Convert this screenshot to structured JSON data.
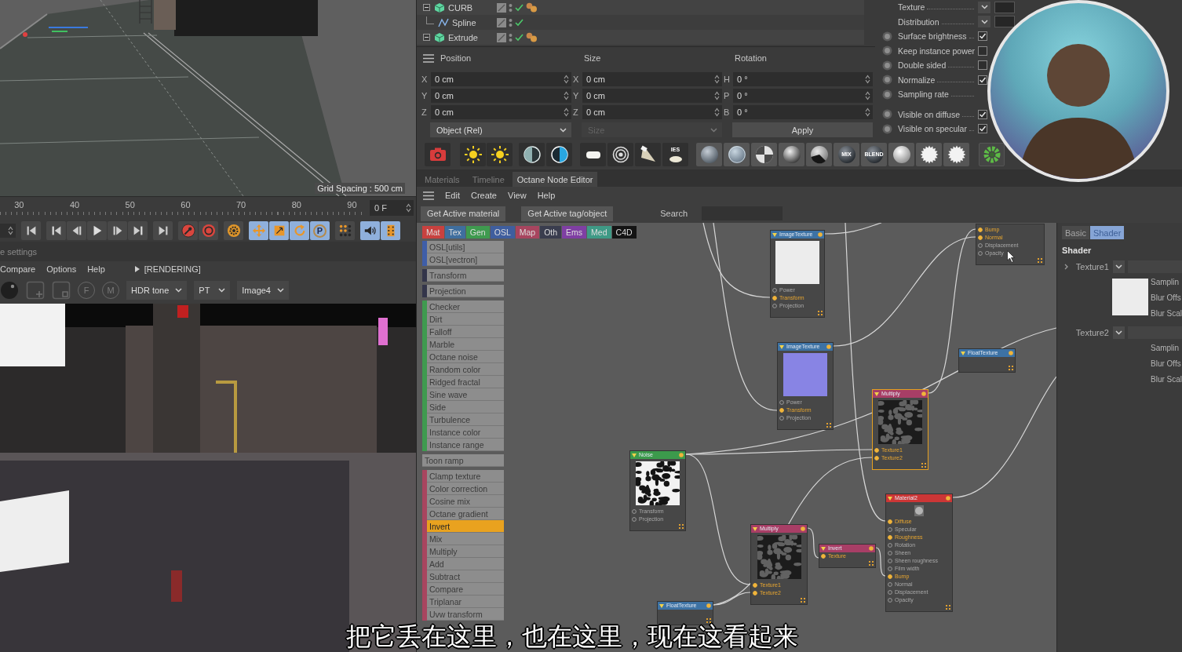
{
  "viewport": {
    "hud": "Grid Spacing : 500 cm"
  },
  "timeline": {
    "ticks": [
      "30",
      "40",
      "50",
      "60",
      "70",
      "80",
      "90"
    ],
    "frame": "0 F"
  },
  "transport": {
    "buttons": [
      {
        "on": false
      },
      {
        "on": false
      },
      {
        "on": false
      },
      {
        "on": false
      },
      {
        "on": false
      },
      {
        "on": false
      },
      {
        "on": false
      },
      {
        "on": false
      },
      {
        "on": false
      },
      {
        "on": false
      },
      {
        "on": true
      },
      {
        "on": true
      },
      {
        "on": true
      },
      {
        "on": true,
        "label": "P"
      },
      {
        "on": false
      },
      {
        "on": true
      },
      {
        "on": true
      }
    ]
  },
  "render_view": {
    "title": "e settings",
    "menu": [
      "Compare",
      "Options",
      "Help"
    ],
    "status": "[RENDERING]",
    "pins": [
      "F",
      "M"
    ],
    "dropdowns": [
      "HDR tone",
      "PT",
      "Image4"
    ]
  },
  "object_manager": {
    "objects": [
      {
        "name": "CURB",
        "kind": "generator",
        "expanded": true,
        "enabled": true,
        "tagged": true,
        "children": [
          {
            "name": "Spline",
            "kind": "spline",
            "enabled": true,
            "tagged": false
          }
        ]
      },
      {
        "name": "Extrude",
        "kind": "generator",
        "expanded": true,
        "enabled": true,
        "tagged": true
      }
    ]
  },
  "coordinates": {
    "columns": [
      {
        "title": "Position",
        "fields": [
          {
            "axis": "X",
            "value": "0 cm"
          },
          {
            "axis": "Y",
            "value": "0 cm"
          },
          {
            "axis": "Z",
            "value": "0 cm"
          }
        ]
      },
      {
        "title": "Size",
        "fields": [
          {
            "axis": "X",
            "value": "0 cm"
          },
          {
            "axis": "Y",
            "value": "0 cm"
          },
          {
            "axis": "Z",
            "value": "0 cm"
          }
        ]
      },
      {
        "title": "Rotation",
        "fields": [
          {
            "axis": "H",
            "value": "0 °"
          },
          {
            "axis": "P",
            "value": "0 °"
          },
          {
            "axis": "B",
            "value": "0 °"
          }
        ]
      }
    ],
    "dropdowns": [
      {
        "value": "Object (Rel)",
        "disabled": false
      },
      {
        "value": "Size",
        "disabled": true
      }
    ],
    "apply": "Apply"
  },
  "attributes": {
    "groups": [
      [
        {
          "label": "Texture",
          "kind": "dropdown"
        },
        {
          "label": "Distribution",
          "kind": "dropdown"
        },
        {
          "label": "Surface brightness",
          "kind": "checkbox",
          "checked": true
        },
        {
          "label": "Keep instance power",
          "kind": "checkbox",
          "checked": false
        },
        {
          "label": "Double sided",
          "kind": "checkbox",
          "checked": false
        },
        {
          "label": "Normalize",
          "kind": "checkbox",
          "checked": true
        },
        {
          "label": "Sampling rate",
          "kind": "label"
        }
      ],
      [
        {
          "label": "Visible on diffuse",
          "kind": "checkbox",
          "checked": true
        },
        {
          "label": "Visible on specular",
          "kind": "checkbox",
          "checked": true
        }
      ]
    ]
  },
  "octane_toolbar": {
    "labels": [
      "IES",
      "MIX",
      "BLEND"
    ]
  },
  "tabs": [
    {
      "label": "Materials",
      "selected": false
    },
    {
      "label": "Timeline",
      "selected": false
    },
    {
      "label": "Octane Node Editor",
      "selected": true
    }
  ],
  "editor_menu": [
    "Edit",
    "Create",
    "View",
    "Help"
  ],
  "editor_buttons": [
    "Get Active material",
    "Get Active tag/object"
  ],
  "search": {
    "label": "Search"
  },
  "categories": [
    {
      "label": "Mat",
      "color": "#c8413f"
    },
    {
      "label": "Tex",
      "color": "#3f6e9e"
    },
    {
      "label": "Gen",
      "color": "#3f9a4f"
    },
    {
      "label": "OSL",
      "color": "#3f5e9e"
    },
    {
      "label": "Map",
      "color": "#a8455f"
    },
    {
      "label": "Oth",
      "color": "#3a3d4e"
    },
    {
      "label": "Ems",
      "color": "#7f3fa3"
    },
    {
      "label": "Med",
      "color": "#3f9a86"
    },
    {
      "label": "C4D",
      "color": "#141414"
    }
  ],
  "node_list": {
    "groups": [
      {
        "color": "#3f5ea8",
        "items": [
          {
            "label": "OSL[utils]",
            "selected": false
          },
          {
            "label": "OSL[vectron]",
            "selected": false
          }
        ]
      },
      {
        "color": "#33354a",
        "items": [
          {
            "label": "Transform",
            "selected": false
          }
        ]
      },
      {
        "color": "#33354a",
        "items": [
          {
            "label": "Projection",
            "selected": false
          }
        ]
      },
      {
        "color": "#3f9a4f",
        "items": [
          {
            "label": "Checker",
            "selected": false
          },
          {
            "label": "Dirt",
            "selected": false
          },
          {
            "label": "Falloff",
            "selected": false
          },
          {
            "label": "Marble",
            "selected": false
          },
          {
            "label": "Octane noise",
            "selected": false
          },
          {
            "label": "Random color",
            "selected": false
          },
          {
            "label": "Ridged fractal",
            "selected": false
          },
          {
            "label": "Sine wave",
            "selected": false
          },
          {
            "label": "Side",
            "selected": false
          },
          {
            "label": "Turbulence",
            "selected": false
          },
          {
            "label": "Instance color",
            "selected": false
          },
          {
            "label": "Instance range",
            "selected": false
          }
        ]
      },
      {
        "items": [
          {
            "label": "Toon ramp",
            "selected": false
          }
        ]
      },
      {
        "color": "#a8455f",
        "items": [
          {
            "label": "Clamp texture",
            "selected": false
          },
          {
            "label": "Color correction",
            "selected": false
          },
          {
            "label": "Cosine mix",
            "selected": false
          },
          {
            "label": "Octane gradient",
            "selected": false
          },
          {
            "label": "Invert",
            "selected": true
          },
          {
            "label": "Mix",
            "selected": false
          },
          {
            "label": "Multiply",
            "selected": false
          },
          {
            "label": "Add",
            "selected": false
          },
          {
            "label": "Subtract",
            "selected": false
          },
          {
            "label": "Compare",
            "selected": false
          },
          {
            "label": "Triplanar",
            "selected": false
          },
          {
            "label": "Uvw transform",
            "selected": false
          }
        ]
      }
    ]
  },
  "nodes": [
    {
      "title": "ImageTexture",
      "kind": "texture",
      "selected": false,
      "preview": {
        "kind": "swatch",
        "color": "#ececec"
      },
      "ports": [
        {
          "label": "Power",
          "connected": false
        },
        {
          "label": "Transform",
          "connected": true
        },
        {
          "label": "Projection",
          "connected": false
        }
      ]
    },
    {
      "title": "ImageTexture",
      "kind": "texture",
      "selected": false,
      "preview": {
        "kind": "swatch",
        "color": "#8884e4"
      },
      "ports": [
        {
          "label": "Power",
          "connected": false
        },
        {
          "label": "Transform",
          "connected": true
        },
        {
          "label": "Projection",
          "connected": false
        }
      ]
    },
    {
      "selected": false,
      "ports": [
        {
          "label": "Bump",
          "connected": true
        },
        {
          "label": "Normal",
          "connected": true
        },
        {
          "label": "Displacement",
          "connected": false
        },
        {
          "label": "Opacity",
          "connected": false
        }
      ]
    },
    {
      "title": "FloatTexture",
      "kind": "texture",
      "selected": false
    },
    {
      "title": "Multiply",
      "kind": "map",
      "selected": true,
      "preview": {
        "kind": "noise_dark"
      },
      "ports": [
        {
          "label": "Texture1",
          "connected": true
        },
        {
          "label": "Texture2",
          "connected": true
        }
      ]
    },
    {
      "title": "Noise",
      "kind": "generator",
      "selected": false,
      "preview": {
        "kind": "noise_light"
      },
      "ports": [
        {
          "label": "Transform",
          "connected": false
        },
        {
          "label": "Projection",
          "connected": false
        }
      ]
    },
    {
      "title": "Multiply",
      "kind": "map",
      "selected": false,
      "preview": {
        "kind": "noise_dark"
      },
      "ports": [
        {
          "label": "Texture1",
          "connected": true
        },
        {
          "label": "Texture2",
          "connected": true
        }
      ]
    },
    {
      "title": "Invert",
      "kind": "map",
      "selected": false,
      "ports": [
        {
          "label": "Texture",
          "connected": true
        }
      ]
    },
    {
      "title": "Material2",
      "kind": "material",
      "selected": false,
      "preview": {
        "kind": "sphere"
      },
      "ports": [
        {
          "label": "Diffuse",
          "connected": true
        },
        {
          "label": "Specular",
          "connected": false
        },
        {
          "label": "Roughness",
          "connected": true
        },
        {
          "label": "Rotation",
          "connected": false
        },
        {
          "label": "Sheen",
          "connected": false
        },
        {
          "label": "Sheen roughness",
          "connected": false
        },
        {
          "label": "Film width",
          "connected": false
        },
        {
          "label": "Bump",
          "connected": true
        },
        {
          "label": "Normal",
          "connected": false
        },
        {
          "label": "Displacement",
          "connected": false
        },
        {
          "label": "Opacity",
          "connected": false
        }
      ]
    },
    {
      "title": "FloatTexture",
      "kind": "texture",
      "selected": false
    }
  ],
  "shader_panel": {
    "tabs": [
      {
        "label": "Basic",
        "selected": false
      },
      {
        "label": "Shader",
        "selected": true
      }
    ],
    "heading": "Shader",
    "textures": [
      {
        "label": "Texture1",
        "expander": true,
        "color": "#ececec",
        "props": [
          "Samplin",
          "Blur Offs",
          "Blur Scal"
        ]
      },
      {
        "label": "Texture2",
        "expander": false,
        "props": [
          "Samplin",
          "Blur Offs",
          "Blur Scal"
        ]
      }
    ]
  },
  "subtitle": "把它丢在这里，也在这里，现在这看起来"
}
